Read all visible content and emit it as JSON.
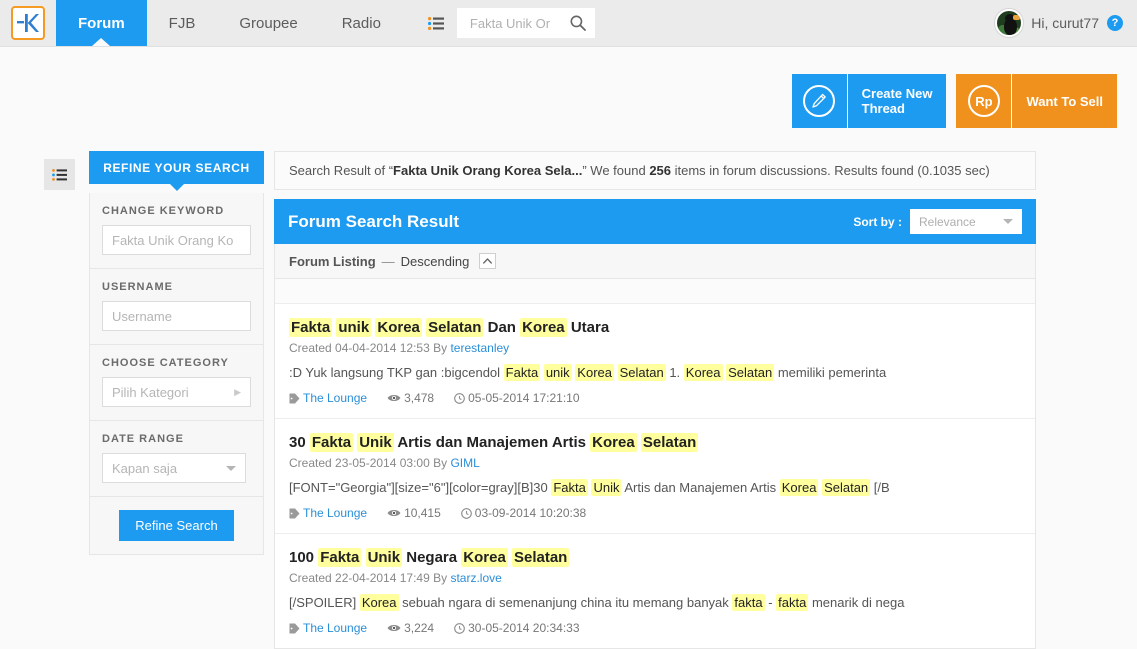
{
  "nav": {
    "logo_alt": "kaskus-logo",
    "tabs": [
      {
        "label": "Forum",
        "active": true
      },
      {
        "label": "FJB",
        "active": false
      },
      {
        "label": "Groupee",
        "active": false
      },
      {
        "label": "Radio",
        "active": false
      }
    ],
    "search": {
      "value": "Fakta Unik Or",
      "placeholder": "Fakta Unik Or"
    },
    "user": {
      "greeting": "Hi, curut77",
      "help": "?"
    }
  },
  "actions": {
    "create_thread": {
      "label": "Create New\nThread",
      "label_line1": "Create New",
      "label_line2": "Thread",
      "icon": "pencil-icon",
      "color": "#1d9bf0"
    },
    "want_to_sell": {
      "label": "Want To Sell",
      "icon": "Rp",
      "color": "#f0911e"
    }
  },
  "sidebar": {
    "tab_label": "REFINE YOUR SEARCH",
    "fields": [
      {
        "label": "CHANGE KEYWORD",
        "type": "input",
        "value": "",
        "placeholder": "Fakta Unik Orang Ko"
      },
      {
        "label": "USERNAME",
        "type": "input",
        "value": "",
        "placeholder": "Username"
      },
      {
        "label": "CHOOSE CATEGORY",
        "type": "select",
        "value": "Pilih Kategori"
      },
      {
        "label": "DATE RANGE",
        "type": "select",
        "value": "Kapan saja"
      }
    ],
    "submit_label": "Refine Search"
  },
  "summary": {
    "prefix": "Search Result of “",
    "query": "Fakta Unik Orang Korea Sela...",
    "mid": "” We found ",
    "count": "256",
    "suffix": " items in forum discussions. Results found (0.1035 sec)"
  },
  "result_header": {
    "title": "Forum Search Result",
    "sort_label": "Sort by :",
    "sort_value": "Relevance"
  },
  "listing_bar": {
    "title": "Forum Listing",
    "dash": "—",
    "order": "Descending"
  },
  "results": [
    {
      "title_parts": [
        {
          "t": "Fakta",
          "hl": true
        },
        {
          "t": " ",
          "hl": false
        },
        {
          "t": "unik",
          "hl": true
        },
        {
          "t": " ",
          "hl": false
        },
        {
          "t": "Korea",
          "hl": true
        },
        {
          "t": " ",
          "hl": false
        },
        {
          "t": "Selatan",
          "hl": true
        },
        {
          "t": " Dan ",
          "hl": false
        },
        {
          "t": "Korea",
          "hl": true
        },
        {
          "t": " Utara",
          "hl": false
        }
      ],
      "created_label": "Created 04-04-2014 12:53 By",
      "author": "terestanley",
      "snippet_parts": [
        {
          "t": ":D Yuk langsung TKP gan :bigcendol ",
          "hl": false
        },
        {
          "t": "Fakta",
          "hl": true
        },
        {
          "t": " ",
          "hl": false
        },
        {
          "t": "unik",
          "hl": true
        },
        {
          "t": " ",
          "hl": false
        },
        {
          "t": "Korea",
          "hl": true
        },
        {
          "t": " ",
          "hl": false
        },
        {
          "t": "Selatan",
          "hl": true
        },
        {
          "t": " 1. ",
          "hl": false
        },
        {
          "t": "Korea",
          "hl": true
        },
        {
          "t": " ",
          "hl": false
        },
        {
          "t": "Selatan",
          "hl": true
        },
        {
          "t": " memiliki pemerinta",
          "hl": false
        }
      ],
      "category": "The Lounge",
      "views": "3,478",
      "date": "05-05-2014 17:21:10"
    },
    {
      "title_parts": [
        {
          "t": "30 ",
          "hl": false
        },
        {
          "t": "Fakta",
          "hl": true
        },
        {
          "t": " ",
          "hl": false
        },
        {
          "t": "Unik",
          "hl": true
        },
        {
          "t": " Artis dan Manajemen Artis ",
          "hl": false
        },
        {
          "t": "Korea",
          "hl": true
        },
        {
          "t": " ",
          "hl": false
        },
        {
          "t": "Selatan",
          "hl": true
        }
      ],
      "created_label": "Created 23-05-2014 03:00 By",
      "author": "GIML",
      "snippet_parts": [
        {
          "t": "[FONT=\"Georgia\"][size=\"6\"][color=gray][B]30 ",
          "hl": false
        },
        {
          "t": "Fakta",
          "hl": true
        },
        {
          "t": " ",
          "hl": false
        },
        {
          "t": "Unik",
          "hl": true
        },
        {
          "t": " Artis dan Manajemen Artis ",
          "hl": false
        },
        {
          "t": "Korea",
          "hl": true
        },
        {
          "t": " ",
          "hl": false
        },
        {
          "t": "Selatan",
          "hl": true
        },
        {
          "t": " [/B",
          "hl": false
        }
      ],
      "category": "The Lounge",
      "views": "10,415",
      "date": "03-09-2014 10:20:38"
    },
    {
      "title_parts": [
        {
          "t": "100 ",
          "hl": false
        },
        {
          "t": "Fakta",
          "hl": true
        },
        {
          "t": " ",
          "hl": false
        },
        {
          "t": "Unik",
          "hl": true
        },
        {
          "t": " Negara ",
          "hl": false
        },
        {
          "t": "Korea",
          "hl": true
        },
        {
          "t": " ",
          "hl": false
        },
        {
          "t": "Selatan",
          "hl": true
        }
      ],
      "created_label": "Created 22-04-2014 17:49 By",
      "author": "starz.love",
      "snippet_parts": [
        {
          "t": "[/SPOILER] ",
          "hl": false
        },
        {
          "t": "Korea",
          "hl": true
        },
        {
          "t": " sebuah ngara di semenanjung china itu memang banyak ",
          "hl": false
        },
        {
          "t": "fakta",
          "hl": true
        },
        {
          "t": " - ",
          "hl": false
        },
        {
          "t": "fakta",
          "hl": true
        },
        {
          "t": " menarik di nega",
          "hl": false
        }
      ],
      "category": "The Lounge",
      "views": "3,224",
      "date": "30-05-2014 20:34:33"
    }
  ],
  "colors": {
    "brand_blue": "#1d9bf0",
    "brand_orange": "#f0911e",
    "highlight": "#ffff9e",
    "link": "#2a8fd8"
  }
}
